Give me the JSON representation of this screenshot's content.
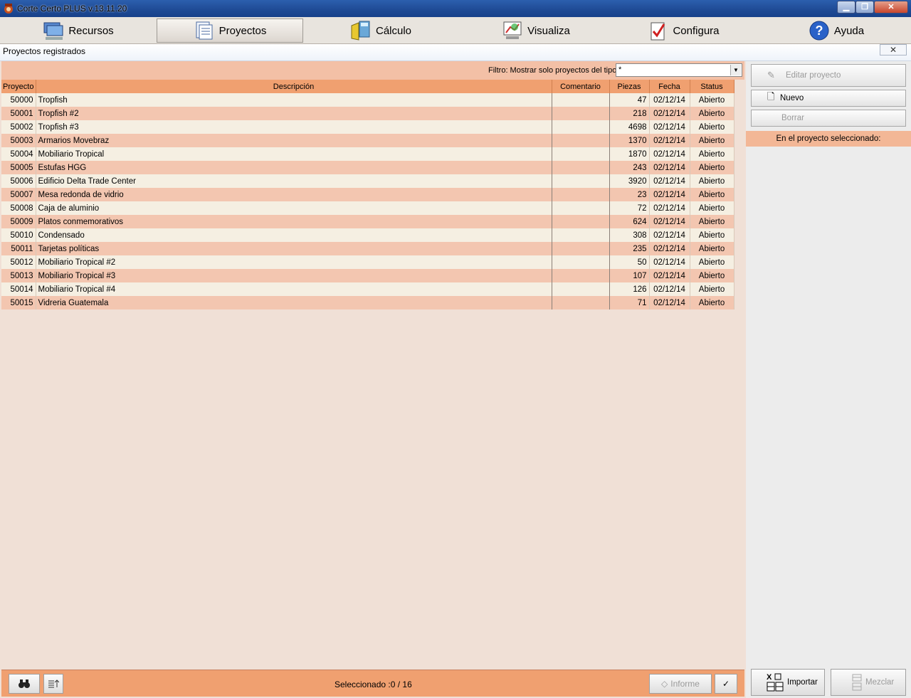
{
  "window": {
    "title": "Corte Certo  PLUS  v.13.11.20",
    "min_icon": "minimize-icon",
    "max_icon": "maximize-icon",
    "close_icon": "close-icon"
  },
  "menu": {
    "items": [
      {
        "label": "Recursos",
        "icon": "resources-icon"
      },
      {
        "label": "Proyectos",
        "icon": "projects-icon"
      },
      {
        "label": "Cálculo",
        "icon": "calculation-icon"
      },
      {
        "label": "Visualiza",
        "icon": "visualize-icon"
      },
      {
        "label": "Configura",
        "icon": "configure-icon"
      },
      {
        "label": "Ayuda",
        "icon": "help-icon"
      }
    ]
  },
  "subheader": {
    "title": "Proyectos registrados",
    "close_label": "✕"
  },
  "filter": {
    "label": "Filtro: Mostrar solo proyectos del tipo:",
    "value": "*"
  },
  "table": {
    "columns": [
      "Proyecto",
      "Descripción",
      "Comentario",
      "Piezas",
      "Fecha",
      "Status"
    ],
    "rows": [
      {
        "id": "50000",
        "desc": "Tropfish",
        "comment": "",
        "pieces": "47",
        "date": "02/12/14",
        "status": "Abierto"
      },
      {
        "id": "50001",
        "desc": "Tropfish #2",
        "comment": "",
        "pieces": "218",
        "date": "02/12/14",
        "status": "Abierto"
      },
      {
        "id": "50002",
        "desc": "Tropfish #3",
        "comment": "",
        "pieces": "4698",
        "date": "02/12/14",
        "status": "Abierto"
      },
      {
        "id": "50003",
        "desc": "Armarios Movebraz",
        "comment": "",
        "pieces": "1370",
        "date": "02/12/14",
        "status": "Abierto"
      },
      {
        "id": "50004",
        "desc": "Mobiliario Tropical",
        "comment": "",
        "pieces": "1870",
        "date": "02/12/14",
        "status": "Abierto"
      },
      {
        "id": "50005",
        "desc": "Estufas HGG",
        "comment": "",
        "pieces": "243",
        "date": "02/12/14",
        "status": "Abierto"
      },
      {
        "id": "50006",
        "desc": "Edificio Delta Trade Center",
        "comment": "",
        "pieces": "3920",
        "date": "02/12/14",
        "status": "Abierto"
      },
      {
        "id": "50007",
        "desc": "Mesa redonda de vidrio",
        "comment": "",
        "pieces": "23",
        "date": "02/12/14",
        "status": "Abierto"
      },
      {
        "id": "50008",
        "desc": "Caja de aluminio",
        "comment": "",
        "pieces": "72",
        "date": "02/12/14",
        "status": "Abierto"
      },
      {
        "id": "50009",
        "desc": "Platos conmemorativos",
        "comment": "",
        "pieces": "624",
        "date": "02/12/14",
        "status": "Abierto"
      },
      {
        "id": "50010",
        "desc": "Condensado",
        "comment": "",
        "pieces": "308",
        "date": "02/12/14",
        "status": "Abierto"
      },
      {
        "id": "50011",
        "desc": "Tarjetas políticas",
        "comment": "",
        "pieces": "235",
        "date": "02/12/14",
        "status": "Abierto"
      },
      {
        "id": "50012",
        "desc": "Mobiliario Tropical #2",
        "comment": "",
        "pieces": "50",
        "date": "02/12/14",
        "status": "Abierto"
      },
      {
        "id": "50013",
        "desc": "Mobiliario Tropical #3",
        "comment": "",
        "pieces": "107",
        "date": "02/12/14",
        "status": "Abierto"
      },
      {
        "id": "50014",
        "desc": "Mobiliario Tropical #4",
        "comment": "",
        "pieces": "126",
        "date": "02/12/14",
        "status": "Abierto"
      },
      {
        "id": "50015",
        "desc": "Vidreria Guatemala",
        "comment": "",
        "pieces": "71",
        "date": "02/12/14",
        "status": "Abierto"
      }
    ]
  },
  "bottom": {
    "search_icon": "binoculars-icon",
    "sort_icon": "sort-icon",
    "status": "Seleccionado :0 / 16",
    "report_label": "Informe",
    "check_icon": "checkmark-icon"
  },
  "sidebar": {
    "edit_label": "Editar proyecto",
    "new_label": "Nuevo",
    "delete_label": "Borrar",
    "selected_info": "En el proyecto seleccionado:",
    "import_label": "Importar",
    "merge_label": "Mezclar"
  },
  "colors": {
    "header_orange": "#f0a070",
    "row_light": "#f5efe2",
    "row_peach": "#f3c6b0",
    "panel_bg": "#f0e0d6"
  }
}
